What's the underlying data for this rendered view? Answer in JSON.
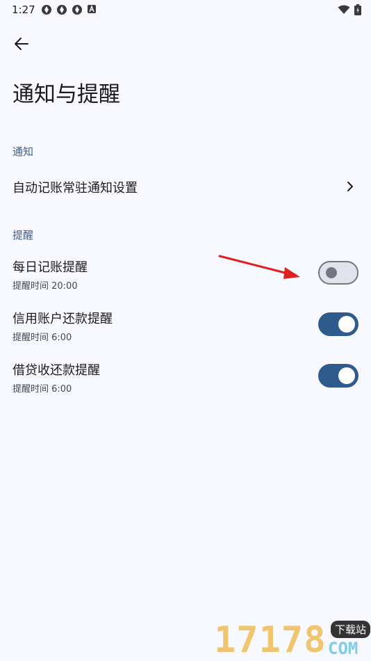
{
  "status_bar": {
    "time": "1:27",
    "left_icons": [
      "app-icon",
      "app-icon",
      "app-icon",
      "a-badge-icon"
    ],
    "right_icons": [
      "wifi-icon",
      "battery-icon"
    ]
  },
  "header": {
    "back_icon": "arrow-left-icon",
    "title": "通知与提醒"
  },
  "sections": {
    "notify": {
      "header": "通知",
      "item_label": "自动记账常驻通知设置",
      "item_icon": "chevron-right-icon"
    },
    "remind": {
      "header": "提醒",
      "items": [
        {
          "label": "每日记账提醒",
          "subtitle": "提醒时间 20:00",
          "enabled": false
        },
        {
          "label": "信用账户还款提醒",
          "subtitle": "提醒时间 6:00",
          "enabled": true
        },
        {
          "label": "借贷收还款提醒",
          "subtitle": "提醒时间 6:00",
          "enabled": true
        }
      ]
    }
  },
  "watermark": {
    "number": "17178",
    "tag": "下载站",
    "domain": "COM"
  },
  "colors": {
    "background": "#f8f9ff",
    "accent": "#2e5b8c",
    "section_header": "#3d5f8f",
    "annotation_arrow": "#e02020"
  }
}
